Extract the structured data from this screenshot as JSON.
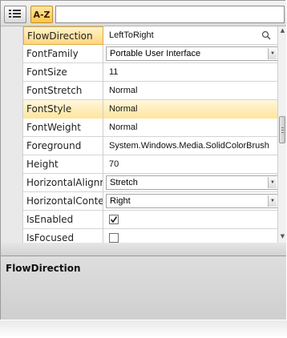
{
  "toolbar": {
    "categorized_icon": "categorized-list-icon",
    "alphabetical_label": "A-Z",
    "search_value": ""
  },
  "properties": [
    {
      "name": "FlowDirection",
      "value": "LeftToRight",
      "editor": "search-text",
      "state": "selected"
    },
    {
      "name": "FontFamily",
      "value": "Portable User Interface",
      "editor": "combo"
    },
    {
      "name": "FontSize",
      "value": "11",
      "editor": "text"
    },
    {
      "name": "FontStretch",
      "value": "Normal",
      "editor": "text"
    },
    {
      "name": "FontStyle",
      "value": "Normal",
      "editor": "text",
      "state": "hover"
    },
    {
      "name": "FontWeight",
      "value": "Normal",
      "editor": "text"
    },
    {
      "name": "Foreground",
      "value": "System.Windows.Media.SolidColorBrush",
      "editor": "text"
    },
    {
      "name": "Height",
      "value": "70",
      "editor": "text"
    },
    {
      "name": "HorizontalAlignme",
      "value": "Stretch",
      "editor": "combo"
    },
    {
      "name": "HorizontalConten",
      "value": "Right",
      "editor": "combo"
    },
    {
      "name": "IsEnabled",
      "value": "",
      "checked": true,
      "editor": "checkbox"
    },
    {
      "name": "IsFocused",
      "value": "",
      "checked": false,
      "editor": "checkbox"
    }
  ],
  "description": {
    "title": "FlowDirection"
  },
  "colors": {
    "selected_bg": "#ffd680",
    "selected_border": "#e0ac3c",
    "accent_az": "#ffc548"
  }
}
